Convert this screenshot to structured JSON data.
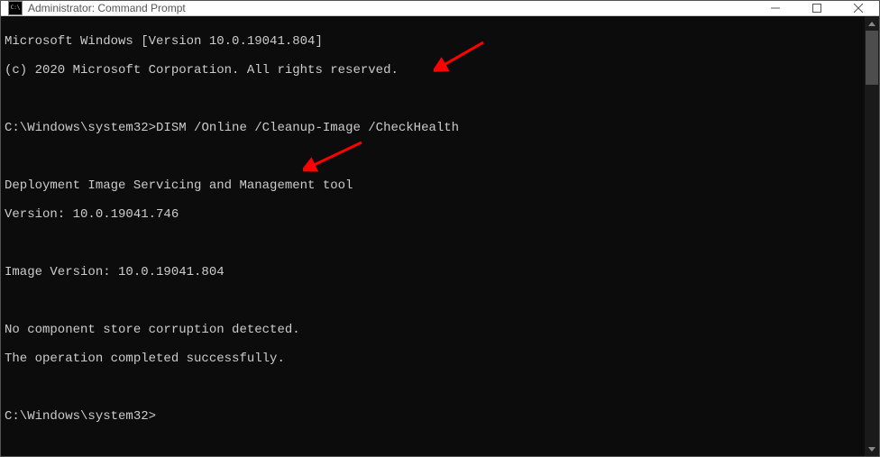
{
  "window": {
    "title": "Administrator: Command Prompt"
  },
  "console": {
    "lines": {
      "l0": "Microsoft Windows [Version 10.0.19041.804]",
      "l1": "(c) 2020 Microsoft Corporation. All rights reserved.",
      "l2": "",
      "prompt1_path": "C:\\Windows\\system32>",
      "prompt1_cmd": "DISM /Online /Cleanup-Image /CheckHealth",
      "l4": "",
      "l5": "Deployment Image Servicing and Management tool",
      "l6": "Version: 10.0.19041.746",
      "l7": "",
      "l8": "Image Version: 10.0.19041.804",
      "l9": "",
      "l10": "No component store corruption detected.",
      "l11": "The operation completed successfully.",
      "l12": "",
      "prompt2_path": "C:\\Windows\\system32>"
    }
  },
  "annotation": {
    "arrow_color": "#ff0000"
  }
}
